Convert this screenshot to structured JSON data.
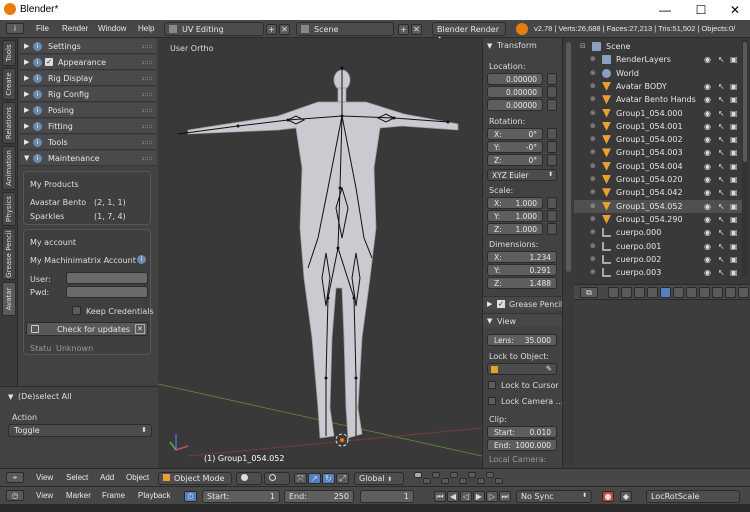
{
  "window": {
    "title": "Blender*",
    "minimize": "—",
    "maximize": "☐",
    "close": "✕"
  },
  "topbar": {
    "menus": [
      "File",
      "Render",
      "Window",
      "Help"
    ],
    "screen_layout": "UV Editing",
    "scene": "Scene",
    "render_engine": "Blender Render",
    "stats": "v2.78 | Verts:26,688 | Faces:27,213 | Tris:51,502 | Objects:0/"
  },
  "left_tabs": [
    "Tools",
    "Create",
    "Relations",
    "Animation",
    "Physics",
    "Grease Pencil",
    "Avatar"
  ],
  "left_panel": {
    "headers": [
      "Settings",
      "Appearance",
      "Rig Display",
      "Rig Config",
      "Posing",
      "Fitting",
      "Tools",
      "Maintenance"
    ],
    "my_products_label": "My Products",
    "products": [
      {
        "name": "Avastar Bento",
        "version": "(2, 1, 1)"
      },
      {
        "name": "Sparkles",
        "version": "(1, 7, 4)"
      }
    ],
    "my_account_label": "My account",
    "machinimatrix_account": "My Machinimatrix Account",
    "info_icon": "i",
    "user_label": "User:",
    "pwd_label": "Pwd:",
    "keep_credentials": "Keep Credentials",
    "check_updates": "Check for updates",
    "status_label": "Statu",
    "status_value": "Unknown"
  },
  "operator_panel": {
    "title": "(De)select All",
    "action_label": "Action",
    "action_value": "Toggle"
  },
  "viewport": {
    "view_label": "User Ortho",
    "object_label": "(1) Group1_054.052"
  },
  "properties": {
    "transform": "Transform",
    "location_label": "Location:",
    "location": [
      "0.00000",
      "0.00000",
      "0.00000"
    ],
    "rotation_label": "Rotation:",
    "rotation": [
      {
        "k": "X:",
        "v": "0°"
      },
      {
        "k": "Y:",
        "v": "-0°"
      },
      {
        "k": "Z:",
        "v": "0°"
      }
    ],
    "rotation_mode": "XYZ Euler",
    "scale_label": "Scale:",
    "scale": [
      {
        "k": "X:",
        "v": "1.000"
      },
      {
        "k": "Y:",
        "v": "1.000"
      },
      {
        "k": "Z:",
        "v": "1.000"
      }
    ],
    "dimensions_label": "Dimensions:",
    "dimensions": [
      {
        "k": "X:",
        "v": "1.234"
      },
      {
        "k": "Y:",
        "v": "0.291"
      },
      {
        "k": "Z:",
        "v": "1.488"
      }
    ],
    "grease_pencil": "Grease Pencil",
    "view": "View",
    "lens_label": "Lens:",
    "lens_value": "35.000",
    "lock_to_object": "Lock to Object:",
    "lock_to_cursor": "Lock to Cursor",
    "lock_camera": "Lock Camera ...",
    "clip_label": "Clip:",
    "clip_start_label": "Start:",
    "clip_start": "0.010",
    "clip_end_label": "End:",
    "clip_end": "1000.000",
    "local_camera": "Local Camera:"
  },
  "outliner": {
    "rows": [
      {
        "name": "Scene",
        "indent": 0,
        "icon": "scene-icon"
      },
      {
        "name": "RenderLayers",
        "indent": 1,
        "icon": "renderlayers-icon"
      },
      {
        "name": "World",
        "indent": 1,
        "icon": "world-icon"
      },
      {
        "name": "Avatar BODY",
        "indent": 1,
        "icon": "object-icon"
      },
      {
        "name": "Avatar Bento Hands",
        "indent": 1,
        "icon": "object-icon"
      },
      {
        "name": "Group1_054.000",
        "indent": 1,
        "icon": "object-icon"
      },
      {
        "name": "Group1_054.001",
        "indent": 1,
        "icon": "object-icon"
      },
      {
        "name": "Group1_054.002",
        "indent": 1,
        "icon": "object-icon"
      },
      {
        "name": "Group1_054.003",
        "indent": 1,
        "icon": "object-icon"
      },
      {
        "name": "Group1_054.004",
        "indent": 1,
        "icon": "object-icon"
      },
      {
        "name": "Group1_054.020",
        "indent": 1,
        "icon": "object-icon"
      },
      {
        "name": "Group1_054.042",
        "indent": 1,
        "icon": "object-icon"
      },
      {
        "name": "Group1_054.052",
        "indent": 1,
        "icon": "object-icon"
      },
      {
        "name": "Group1_054.290",
        "indent": 1,
        "icon": "object-icon"
      },
      {
        "name": "cuerpo.000",
        "indent": 1,
        "icon": "mesh-icon"
      },
      {
        "name": "cuerpo.001",
        "indent": 1,
        "icon": "mesh-icon"
      },
      {
        "name": "cuerpo.002",
        "indent": 1,
        "icon": "mesh-icon"
      },
      {
        "name": "cuerpo.003",
        "indent": 1,
        "icon": "mesh-icon"
      }
    ]
  },
  "viewport_header": {
    "menus": [
      "View",
      "Select",
      "Add",
      "Object"
    ],
    "mode": "Object Mode",
    "orientation": "Global"
  },
  "timeline": {
    "menus": [
      "View",
      "Marker",
      "Frame",
      "Playback"
    ],
    "start_label": "Start:",
    "start": "1",
    "end_label": "End:",
    "end": "250",
    "current": "1",
    "sync": "No Sync",
    "keying_set": "LocRotScale"
  },
  "colors": {
    "accent": "#e87d0d",
    "select_blue": "#5680c2",
    "panel": "#424242",
    "viewport": "#393939"
  }
}
